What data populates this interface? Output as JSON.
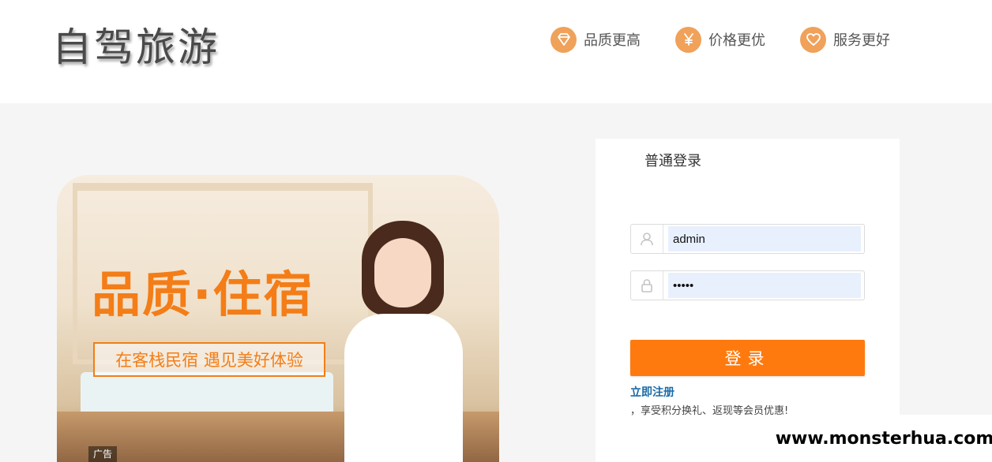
{
  "header": {
    "logo_text": "自驾旅游",
    "features": [
      {
        "icon": "diamond-icon",
        "label": "品质更高"
      },
      {
        "icon": "yen-icon",
        "label": "价格更优"
      },
      {
        "icon": "heart-icon",
        "label": "服务更好"
      }
    ]
  },
  "banner": {
    "title": "品质·住宿",
    "subtitle": "在客栈民宿 遇见美好体验",
    "ad_tag": "广告"
  },
  "login": {
    "tab_label": "普通登录",
    "username_value": "admin",
    "password_value": "12345",
    "submit_label": "登录",
    "register_link": "立即注册",
    "register_note": "，享受积分换礼、返现等会员优惠!"
  },
  "watermark": "www.monsterhua.com",
  "colors": {
    "accent": "#ff7a0e",
    "feature_icon_bg": "#f0a15a",
    "link": "#1a6aa8",
    "autofill_bg": "#e8f0fe"
  }
}
